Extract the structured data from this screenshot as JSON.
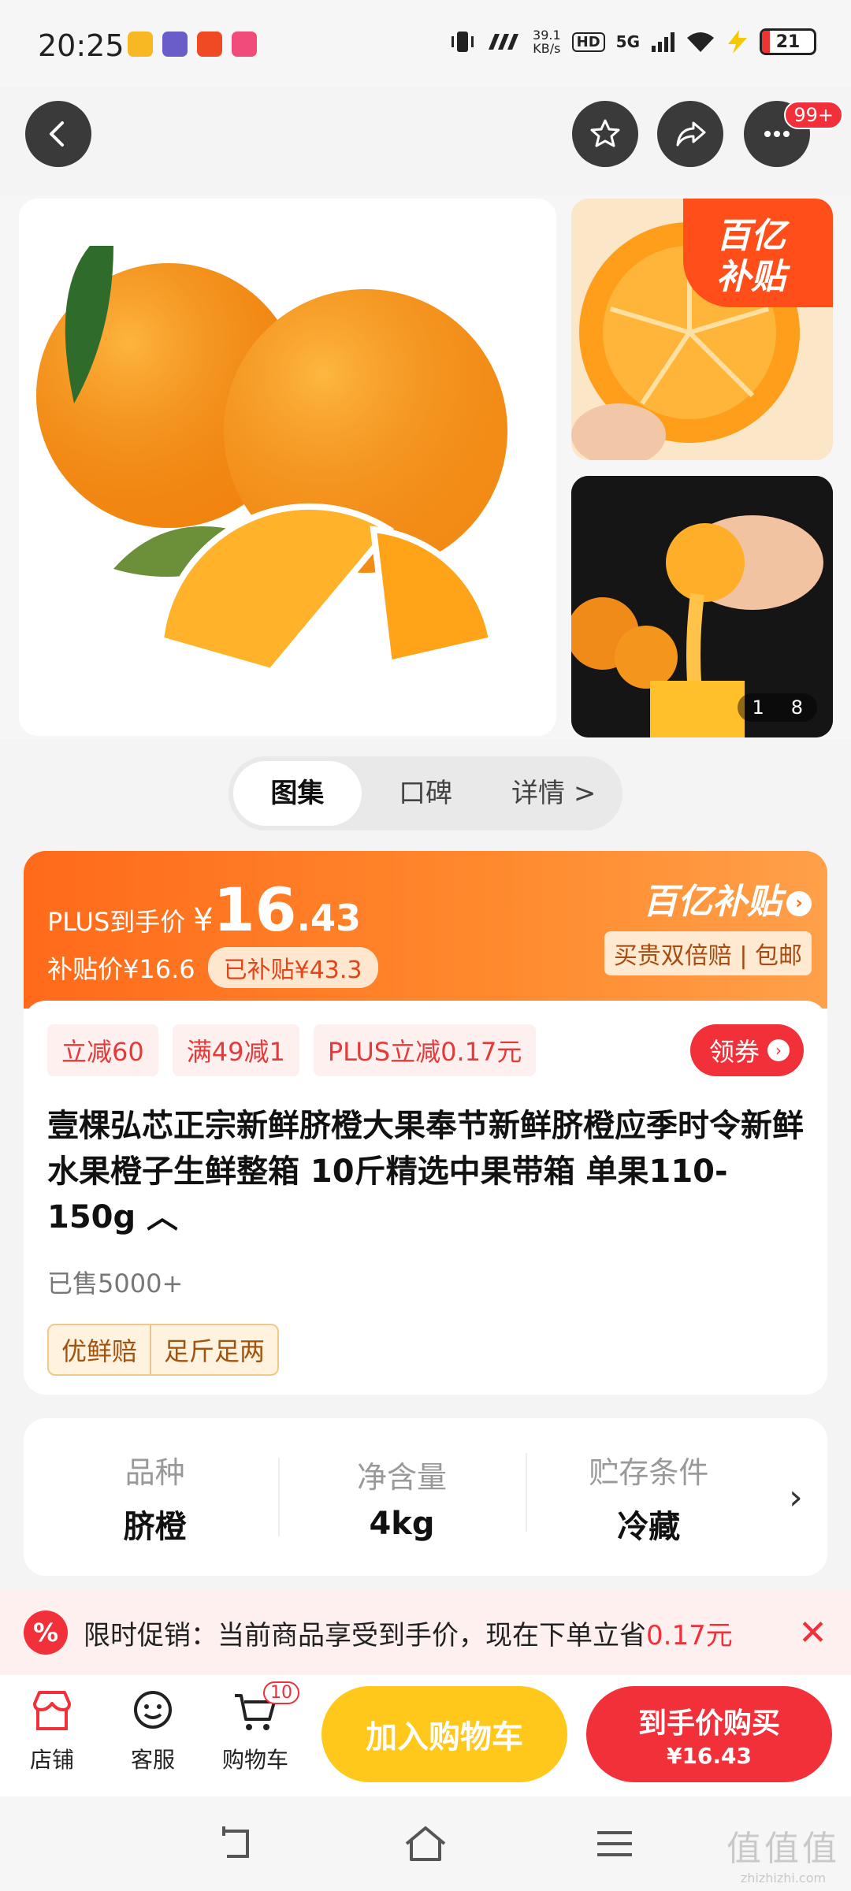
{
  "status_bar": {
    "time": "20:25",
    "net_speed_value": "39.1",
    "net_speed_unit": "KB/s",
    "hd": "HD",
    "signal": "5G",
    "battery": "21"
  },
  "nav": {
    "more_badge": "99+"
  },
  "gallery": {
    "subsidy_tag_line1": "百亿",
    "subsidy_tag_line2": "补贴",
    "pager_current": "1",
    "pager_total": "8"
  },
  "tabs": [
    {
      "label": "图集",
      "active": true
    },
    {
      "label": "口碑",
      "active": false
    },
    {
      "label": "详情 >",
      "active": false
    }
  ],
  "price": {
    "plus_label": "PLUS到手价",
    "currency": "¥",
    "price_int": "16",
    "price_dec": ".43",
    "subsidy_price": "补贴价¥16.6",
    "subsidized_chip": "已补贴¥43.3",
    "brand": "百亿补贴",
    "guarantee": "买贵双倍赔 | 包邮"
  },
  "promos": [
    "立减60",
    "满49减1",
    "PLUS立减0.17元"
  ],
  "coupon_label": "领券",
  "product": {
    "title": "壹棵弘芯正宗新鲜脐橙大果奉节新鲜脐橙应季时令新鲜水果橙子生鲜整箱 10斤精选中果带箱 单果110-150g ︿",
    "sold": "已售5000+",
    "tags": [
      "优鲜赔",
      "足斤足两"
    ]
  },
  "specs": [
    {
      "label": "品种",
      "value": "脐橙"
    },
    {
      "label": "净含量",
      "value": "4kg"
    },
    {
      "label": "贮存条件",
      "value": "冷藏"
    }
  ],
  "promo_banner": {
    "text": "限时促销：当前商品享受到手价，现在下单立省",
    "amount": "0.17元"
  },
  "bottom_bar": {
    "shop": "店铺",
    "service": "客服",
    "cart": "购物车",
    "cart_count": "10",
    "add_to_cart": "加入购物车",
    "buy_line1": "到手价购买",
    "buy_line2": "¥16.43"
  },
  "watermark": {
    "big": "值值值",
    "small": "zhizhizhi.com"
  },
  "colors": {
    "accent_red": "#f2303a",
    "accent_orange": "#ff6a1a",
    "cart_yellow": "#ffc81a"
  }
}
